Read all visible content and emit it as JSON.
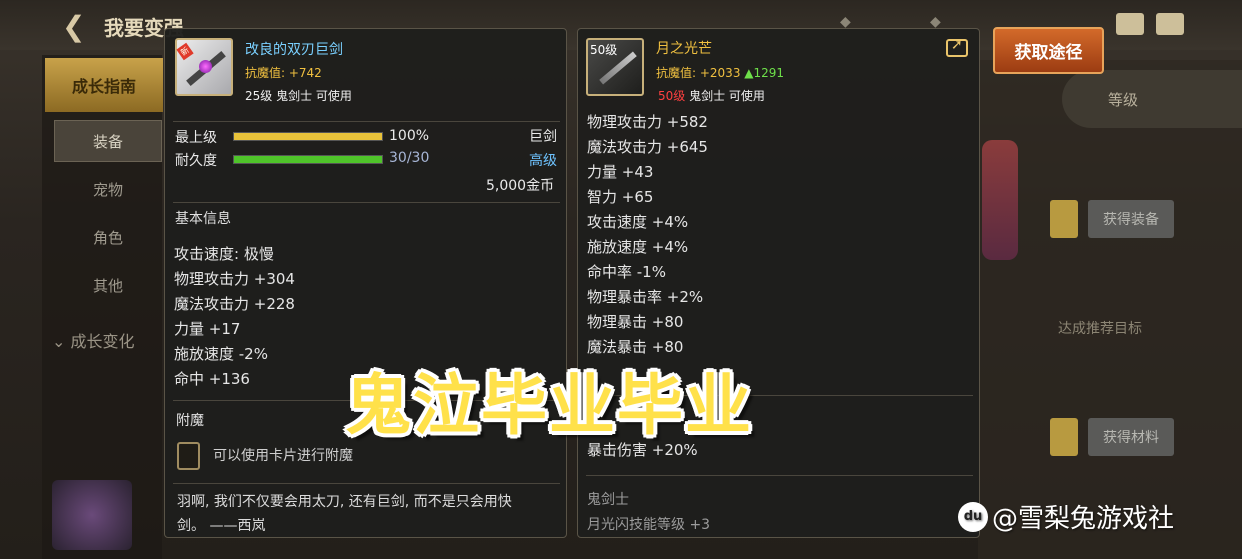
{
  "background": {
    "page_title": "我要变强",
    "nav_main": "成长指南",
    "nav_items": [
      "装备",
      "宠物",
      "角色",
      "其他"
    ],
    "nav_growth": "成长变化",
    "level_tab": "等级",
    "right_buttons": [
      "获得装备",
      "获得材料"
    ],
    "right_text": "达成推荐目标"
  },
  "left_item": {
    "name": "改良的双刃巨剑",
    "name_color": "#7ad0ff",
    "badge": "新",
    "magic_resist": "抗魔值: +742",
    "requirement": "25级 鬼剑士 可使用",
    "top_level_label": "最上级",
    "top_level_percent": 1.0,
    "top_level_value": "100%",
    "weapon_type": "巨剑",
    "durability_label": "耐久度",
    "durability_percent": 1.0,
    "durability_value": "30/30",
    "grade": "高级",
    "grade_color": "#6ec3ff",
    "price": "5,000金币",
    "basic_info_title": "基本信息",
    "stats": [
      "攻击速度: 极慢",
      "物理攻击力 +304",
      "魔法攻击力 +228",
      "力量 +17",
      "施放速度 -2%",
      "命中 +136"
    ],
    "enchant_title": "附魔",
    "enchant_hint": "可以使用卡片进行附魔",
    "flavor_text_1": "羽啊, 我们不仅要会用太刀, 还有巨剑, 而不是只会用快",
    "flavor_text_2": "剑。 ——西岚"
  },
  "right_item": {
    "name": "月之光芒",
    "name_color": "#f0c040",
    "level_badge": "50级",
    "magic_resist": "抗魔值: +2033",
    "magic_resist_up": "▲1291",
    "req_level": "50级",
    "req_rest": "鬼剑士 可使用",
    "stats": [
      "物理攻击力 +582",
      "魔法攻击力 +645",
      "力量 +43",
      "智力 +65",
      "攻击速度 +4%",
      "施放速度 +4%",
      "命中率 -1%",
      "物理暴击率 +2%",
      "物理暴击 +80",
      "魔法暴击 +80"
    ],
    "crit_damage": "暴击伤害 +20%",
    "class_label": "鬼剑士",
    "skill_bonus": "月光闪技能等级 +3"
  },
  "obtain_button": "获取途径",
  "overlay_title": "鬼泣毕业毕业",
  "watermark": {
    "logo": "du",
    "text": "@雪梨兔游戏社"
  },
  "colors": {
    "gold": "#f0c040",
    "green_up": "#6ee04a",
    "red_level": "#ff4040",
    "bar_gold": "#e8c23a",
    "bar_green": "#4fc42a"
  }
}
